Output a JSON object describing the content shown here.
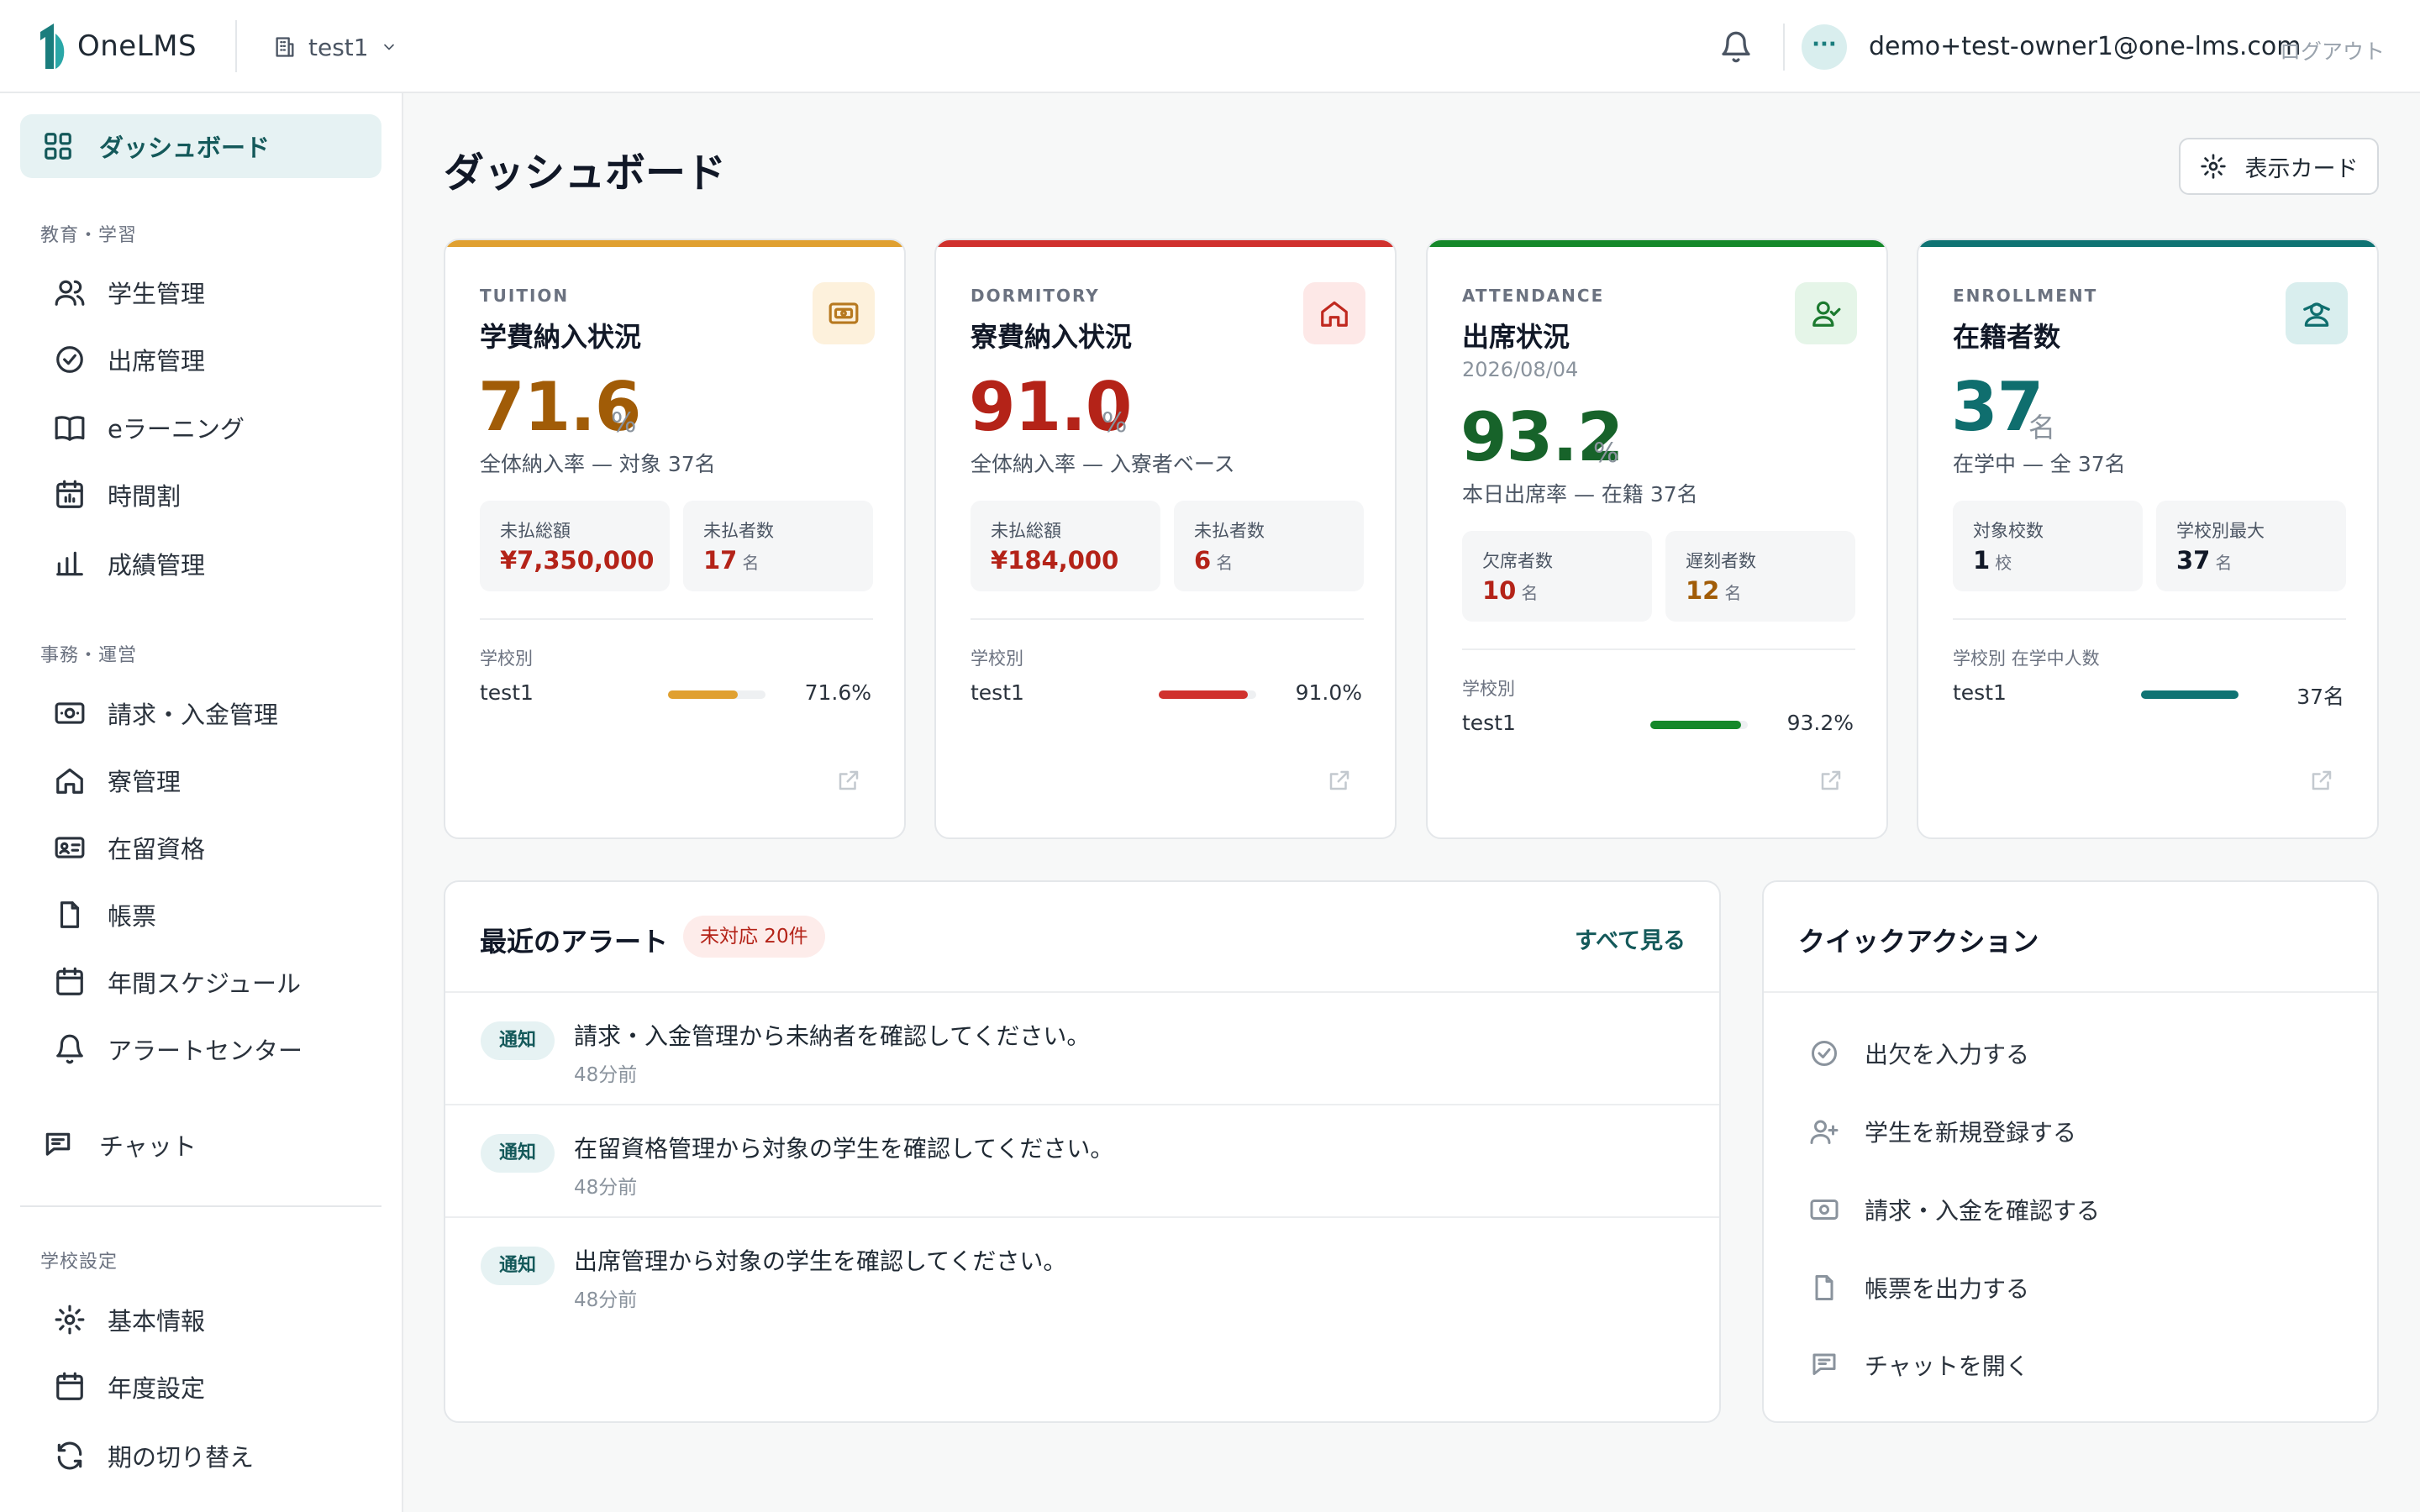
{
  "header": {
    "logo_text": "OneLMS",
    "school": "test1",
    "user_email": "demo+test-owner1@one-lms.com",
    "logout": "ログアウト",
    "avatar_text": "···"
  },
  "sidebar": {
    "dashboard": "ダッシュボード",
    "section_edu": "教育・学習",
    "students": "学生管理",
    "attendance": "出席管理",
    "elearning": "eラーニング",
    "timetable": "時間割",
    "grades": "成績管理",
    "section_ops": "事務・運営",
    "billing": "請求・入金管理",
    "dorm": "寮管理",
    "residence": "在留資格",
    "forms": "帳票",
    "schedule": "年間スケジュール",
    "alert_center": "アラートセンター",
    "chat": "チャット",
    "section_school": "学校設定",
    "basic_info": "基本情報",
    "year_settings": "年度設定",
    "term_switch": "期の切り替え"
  },
  "main": {
    "title": "ダッシュボード",
    "display_cards_button": "表示カード"
  },
  "cards": {
    "tuition": {
      "eyebrow": "TUITION",
      "title": "学費納入状況",
      "value": "71.6",
      "unit": "%",
      "subtext": "全体納入率 — 対象 37名",
      "stat1_label": "未払総額",
      "stat1_value": "¥7,350,000",
      "stat2_label": "未払者数",
      "stat2_value": "17",
      "stat2_unit": "名",
      "group_label": "学校別",
      "row_name": "test1",
      "row_pct": "71.6%",
      "row_fraction": 0.716,
      "accent": "#e0a030",
      "value_color": "#a15c07"
    },
    "dormitory": {
      "eyebrow": "DORMITORY",
      "title": "寮費納入状況",
      "value": "91.0",
      "unit": "%",
      "subtext": "全体納入率 — 入寮者ベース",
      "stat1_label": "未払総額",
      "stat1_value": "¥184,000",
      "stat2_label": "未払者数",
      "stat2_value": "6",
      "stat2_unit": "名",
      "group_label": "学校別",
      "row_name": "test1",
      "row_pct": "91.0%",
      "row_fraction": 0.91,
      "accent": "#d0312d",
      "value_color": "#b42318"
    },
    "attendance": {
      "eyebrow": "ATTENDANCE",
      "title": "出席状況",
      "date": "2026/08/04",
      "value": "93.2",
      "unit": "%",
      "subtext": "本日出席率 — 在籍 37名",
      "stat1_label": "欠席者数",
      "stat1_value": "10",
      "stat1_unit": "名",
      "stat2_label": "遅刻者数",
      "stat2_value": "12",
      "stat2_unit": "名",
      "group_label": "学校別",
      "row_name": "test1",
      "row_pct": "93.2%",
      "row_fraction": 0.932,
      "accent": "#15882a",
      "value_color": "#17632a"
    },
    "enrollment": {
      "eyebrow": "ENROLLMENT",
      "title": "在籍者数",
      "value": "37",
      "unit": "名",
      "subtext": "在学中 — 全 37名",
      "stat1_label": "対象校数",
      "stat1_value": "1",
      "stat1_unit": "校",
      "stat2_label": "学校別最大",
      "stat2_value": "37",
      "stat2_unit": "名",
      "group_label": "学校別 在学中人数",
      "row_name": "test1",
      "row_pct": "37名",
      "row_fraction": 1.0,
      "accent": "#0f7373",
      "value_color": "#0f6e6e"
    }
  },
  "alerts": {
    "title": "最近のアラート",
    "pill": "未対応 20件",
    "see_all": "すべて見る",
    "items": [
      {
        "badge": "通知",
        "text": "請求・入金管理から未納者を確認してください。",
        "time": "48分前"
      },
      {
        "badge": "通知",
        "text": "在留資格管理から対象の学生を確認してください。",
        "time": "48分前"
      },
      {
        "badge": "通知",
        "text": "出席管理から対象の学生を確認してください。",
        "time": "48分前"
      }
    ]
  },
  "quick_actions": {
    "title": "クイックアクション",
    "items": [
      {
        "label": "出欠を入力する",
        "icon": "check-circle-icon"
      },
      {
        "label": "学生を新規登録する",
        "icon": "user-plus-icon"
      },
      {
        "label": "請求・入金を確認する",
        "icon": "banknote-icon"
      },
      {
        "label": "帳票を出力する",
        "icon": "file-icon"
      },
      {
        "label": "チャットを開く",
        "icon": "chat-icon"
      }
    ]
  },
  "colors": {
    "brand": "#14595a",
    "brand_soft": "#e6f2f3"
  }
}
